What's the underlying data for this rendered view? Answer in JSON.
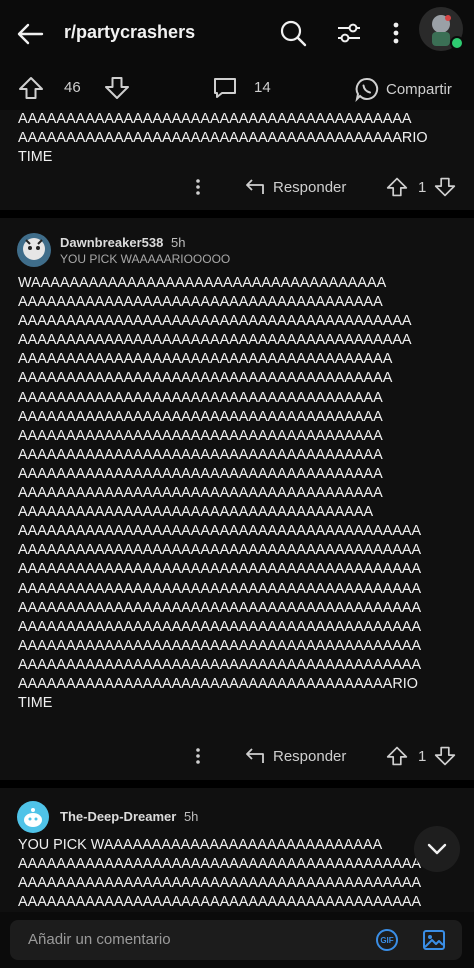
{
  "header": {
    "title": "r/partycrashers"
  },
  "post_actions": {
    "upvotes": "46",
    "comments": "14",
    "share_label": "Compartir"
  },
  "comments": [
    {
      "text": "AAAAAAAAAAAAAAAAAAAAAAAAAAAAAAAAAAAAAAAAA\nAAAAAAAAAAAAAAAAAAAAAAAAAAAAAAAAAAAAAAAARIO\nTIME",
      "reply_label": "Responder",
      "score": "1"
    },
    {
      "username": "Dawnbreaker538",
      "time": "5h",
      "flair": "YOU PICK WAAAAARIOOOOO",
      "text": "WAAAAAAAAAAAAAAAAAAAAAAAAAAAAAAAAAAAAA\nAAAAAAAAAAAAAAAAAAAAAAAAAAAAAAAAAAAAAA\nAAAAAAAAAAAAAAAAAAAAAAAAAAAAAAAAAAAAAAAAA\nAAAAAAAAAAAAAAAAAAAAAAAAAAAAAAAAAAAAAAAAA\nAAAAAAAAAAAAAAAAAAAAAAAAAAAAAAAAAAAAAAA\nAAAAAAAAAAAAAAAAAAAAAAAAAAAAAAAAAAAAAAA\nAAAAAAAAAAAAAAAAAAAAAAAAAAAAAAAAAAAAAA\nAAAAAAAAAAAAAAAAAAAAAAAAAAAAAAAAAAAAAA\nAAAAAAAAAAAAAAAAAAAAAAAAAAAAAAAAAAAAAA\nAAAAAAAAAAAAAAAAAAAAAAAAAAAAAAAAAAAAAA\nAAAAAAAAAAAAAAAAAAAAAAAAAAAAAAAAAAAAAA\nAAAAAAAAAAAAAAAAAAAAAAAAAAAAAAAAAAAAAA\nAAAAAAAAAAAAAAAAAAAAAAAAAAAAAAAAAAAAA\nAAAAAAAAAAAAAAAAAAAAAAAAAAAAAAAAAAAAAAAAAA\nAAAAAAAAAAAAAAAAAAAAAAAAAAAAAAAAAAAAAAAAAA\nAAAAAAAAAAAAAAAAAAAAAAAAAAAAAAAAAAAAAAAAAA\nAAAAAAAAAAAAAAAAAAAAAAAAAAAAAAAAAAAAAAAAAA\nAAAAAAAAAAAAAAAAAAAAAAAAAAAAAAAAAAAAAAAAAA\nAAAAAAAAAAAAAAAAAAAAAAAAAAAAAAAAAAAAAAAAAA\nAAAAAAAAAAAAAAAAAAAAAAAAAAAAAAAAAAAAAAAAAA\nAAAAAAAAAAAAAAAAAAAAAAAAAAAAAAAAAAAAAAAAAA\nAAAAAAAAAAAAAAAAAAAAAAAAAAAAAAAAAAAAAAARIO\nTIME",
      "reply_label": "Responder",
      "score": "1"
    },
    {
      "username": "The-Deep-Dreamer",
      "time": "5h",
      "text": "YOU PICK WAAAAAAAAAAAAAAAAAAAAAAAAAAAAA\nAAAAAAAAAAAAAAAAAAAAAAAAAAAAAAAAAAAAAAAAAA\nAAAAAAAAAAAAAAAAAAAAAAAAAAAAAAAAAAAAAAAAAA\nAAAAAAAAAAAAAAAAAAAAAAAAAAAAAAAAAAAAAAAAAA"
    }
  ],
  "comment_bar": {
    "placeholder": "Añadir un comentario",
    "gif_label": "GIF"
  },
  "colors": {
    "background": "#000000",
    "card": "#101010",
    "accent": "#3a8ee6",
    "online": "#2ecc71"
  }
}
